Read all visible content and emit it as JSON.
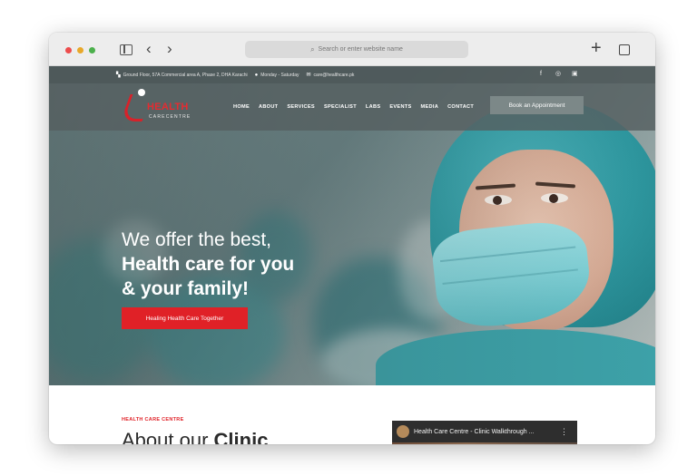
{
  "browser": {
    "url_placeholder": "Search or enter website name"
  },
  "infobar": {
    "address": "Ground Floor, 57A Commercial area A, Phase 2, DHA Karachi",
    "hours": "Monday - Saturday",
    "email": "care@healthcare.pk",
    "social": [
      "facebook-icon",
      "instagram-icon",
      "youtube-icon"
    ]
  },
  "header": {
    "logo_word": "HEALTH",
    "logo_sub": "CARECENTRE",
    "nav": [
      "HOME",
      "ABOUT",
      "SERVICES",
      "SPECIALIST",
      "LABS",
      "EVENTS",
      "MEDIA",
      "CONTACT"
    ],
    "cta": "Book an Appointment"
  },
  "hero": {
    "line1": "We offer the best,",
    "line2": "Health care for you",
    "line3": "& your family!",
    "cta": "Healing Health Care Together"
  },
  "about": {
    "kicker": "HEALTH CARE CENTRE",
    "title_light": "About our",
    "title_bold": "Clinic"
  },
  "video": {
    "title": "Health Care Centre - Clinic Walkthrough ..."
  },
  "colors": {
    "brand_red": "#e02127",
    "teal": "#3da1a8"
  }
}
